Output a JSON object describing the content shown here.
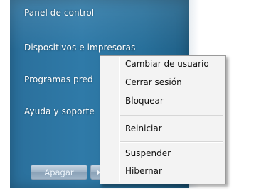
{
  "start_menu": {
    "right_pane_items": [
      {
        "label": "Panel de control"
      },
      {
        "label": "Dispositivos e impresoras"
      },
      {
        "label": "Programas pred"
      },
      {
        "label": "Ayuda y soporte"
      }
    ],
    "shutdown_button_label": "Apagar"
  },
  "shutdown_menu": {
    "items": [
      {
        "label": "Cambiar de usuario"
      },
      {
        "label": "Cerrar sesión"
      },
      {
        "label": "Bloquear"
      },
      {
        "label": "Reiniciar"
      },
      {
        "label": "Suspender"
      },
      {
        "label": "Hibernar"
      }
    ]
  },
  "colors": {
    "panel_blue": "#2f7aa8",
    "menu_background": "#f3f3f3",
    "menu_border": "#9a9a9a",
    "button_gray": "#9fb3c6"
  }
}
